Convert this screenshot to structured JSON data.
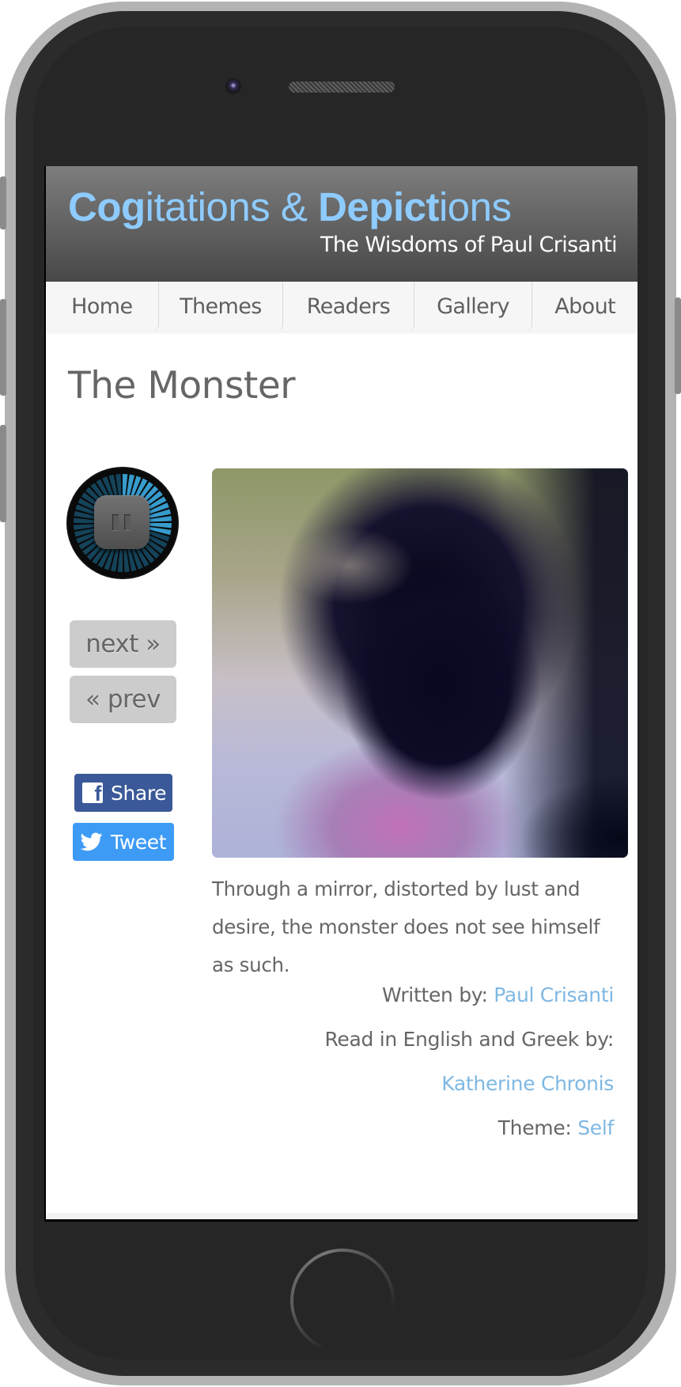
{
  "site": {
    "title_parts": [
      {
        "text": "Cog",
        "bold": true
      },
      {
        "text": "itations & ",
        "bold": false
      },
      {
        "text": "Depict",
        "bold": true
      },
      {
        "text": "ions",
        "bold": false
      }
    ],
    "tagline": "The Wisdoms of Paul Crisanti",
    "accent_color": "#8ecbff",
    "link_color": "#7fb8e3"
  },
  "nav": {
    "items": [
      {
        "label": "Home"
      },
      {
        "label": "Themes"
      },
      {
        "label": "Readers"
      },
      {
        "label": "Gallery"
      },
      {
        "label": "About"
      }
    ]
  },
  "page": {
    "title": "The Monster",
    "player": {
      "state": "playing",
      "control_icon": "pause-icon"
    },
    "pager": {
      "next_label": "next »",
      "prev_label": "« prev"
    },
    "share": {
      "facebook_label": "Share",
      "facebook_icon": "facebook-icon",
      "facebook_color": "#3b5998",
      "twitter_label": "Tweet",
      "twitter_icon": "twitter-bird-icon",
      "twitter_color": "#3d9bf5"
    },
    "artwork_alt": "Blurred, distorted portrait of a man in purple and dark tones",
    "description": "Through a mirror, distorted by lust and desire, the monster does not see himself as such.",
    "credits": {
      "written_by_label": "Written by:",
      "written_by": "Paul Crisanti",
      "read_by_label": "Read in English and Greek by:",
      "read_by": "Katherine Chronis",
      "theme_label": "Theme:",
      "theme": "Self"
    }
  }
}
